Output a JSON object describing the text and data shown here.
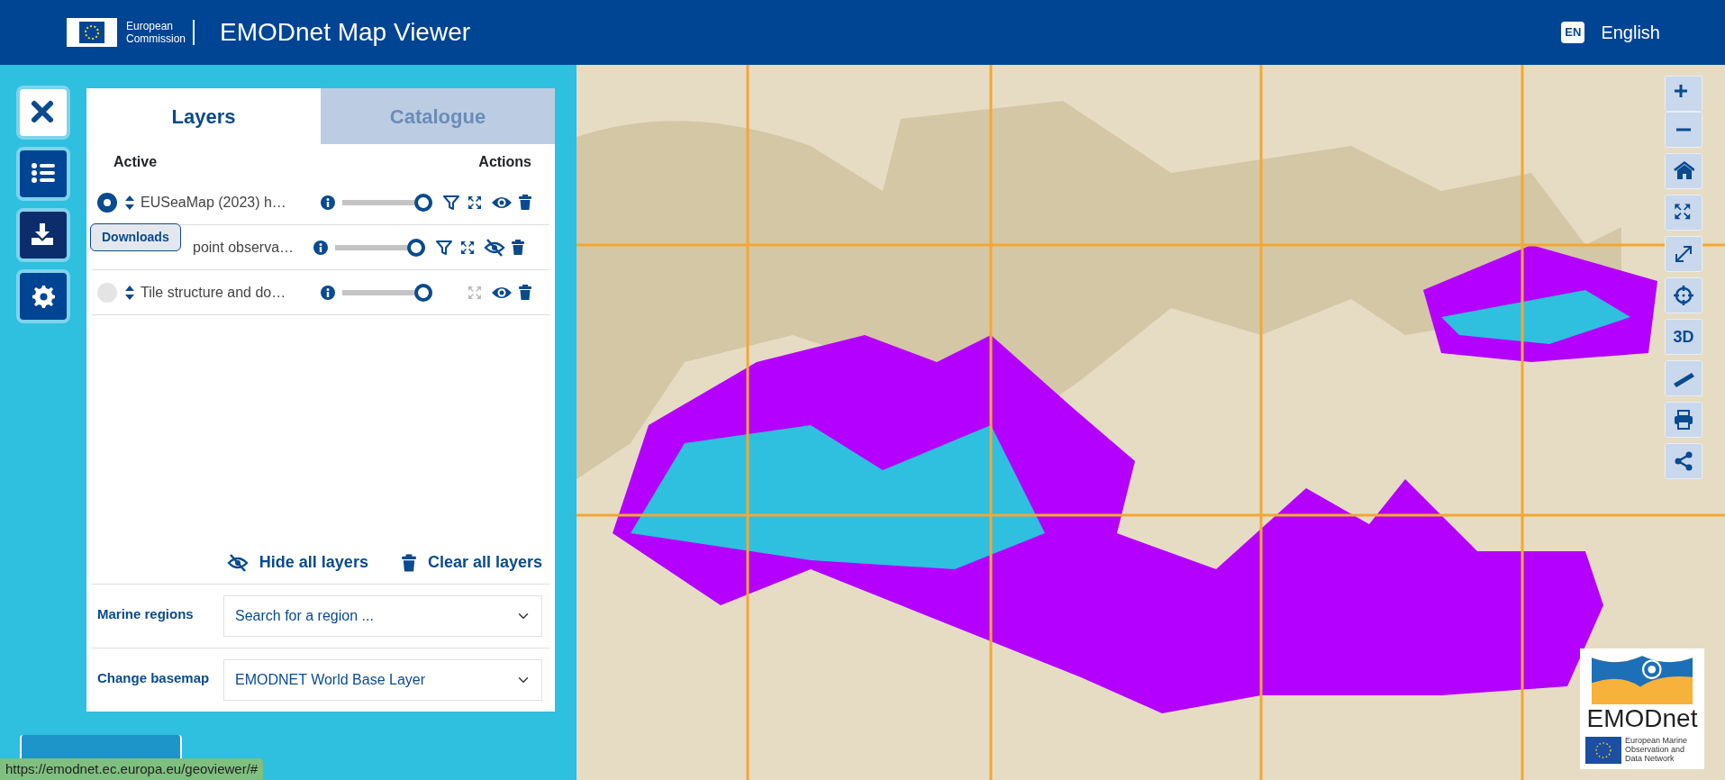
{
  "header": {
    "logo_lines": [
      "European",
      "Commission"
    ],
    "title": "EMODnet Map Viewer",
    "language_code": "EN",
    "language": "English"
  },
  "side_buttons": [
    {
      "kind": "close",
      "highlighted": false
    },
    {
      "kind": "layers",
      "highlighted": false
    },
    {
      "kind": "download",
      "highlighted": true
    },
    {
      "kind": "settings",
      "highlighted": false
    }
  ],
  "tooltip": {
    "text": "Downloads"
  },
  "panel": {
    "tabs": [
      {
        "label": "Layers",
        "selected": true
      },
      {
        "label": "Catalogue",
        "selected": false
      }
    ],
    "columns": [
      "Active",
      "Actions"
    ],
    "layers": [
      {
        "name": "EUSeaMap (2023) h…",
        "active": true,
        "level": 1,
        "filter": true,
        "zoom_enabled": true,
        "visible": true
      },
      {
        "name": "point observa…",
        "level": 1,
        "filter": true,
        "zoom_enabled": true,
        "visible": false
      },
      {
        "name": "Tile structure and do…",
        "active": false,
        "level": 1,
        "filter": false,
        "zoom_enabled": false,
        "visible": true
      }
    ],
    "footer_actions": [
      {
        "kind": "hide",
        "label": "Hide all layers"
      },
      {
        "kind": "clear",
        "label": "Clear all layers"
      }
    ],
    "fields": [
      {
        "kind": "search",
        "label": "Marine regions",
        "placeholder": "Search for a region ..."
      },
      {
        "kind": "select",
        "label": "Change basemap",
        "value": "EMODNET World Base Layer"
      }
    ]
  },
  "map_tools": [
    {
      "kind": "zoom_in"
    },
    {
      "kind": "zoom_out"
    },
    {
      "kind": "home"
    },
    {
      "kind": "extent"
    },
    {
      "kind": "fullscreen"
    },
    {
      "kind": "locate"
    },
    {
      "kind": "view3d",
      "label": "3D"
    },
    {
      "kind": "measure"
    },
    {
      "kind": "print"
    },
    {
      "kind": "share"
    }
  ],
  "logo": {
    "name": "EMODnet",
    "subtitle_lines": [
      "European Marine",
      "Observation and",
      "Data Network"
    ]
  },
  "status_bar": {
    "url": "https://emodnet.ec.europa.eu/geoviewer/#"
  }
}
